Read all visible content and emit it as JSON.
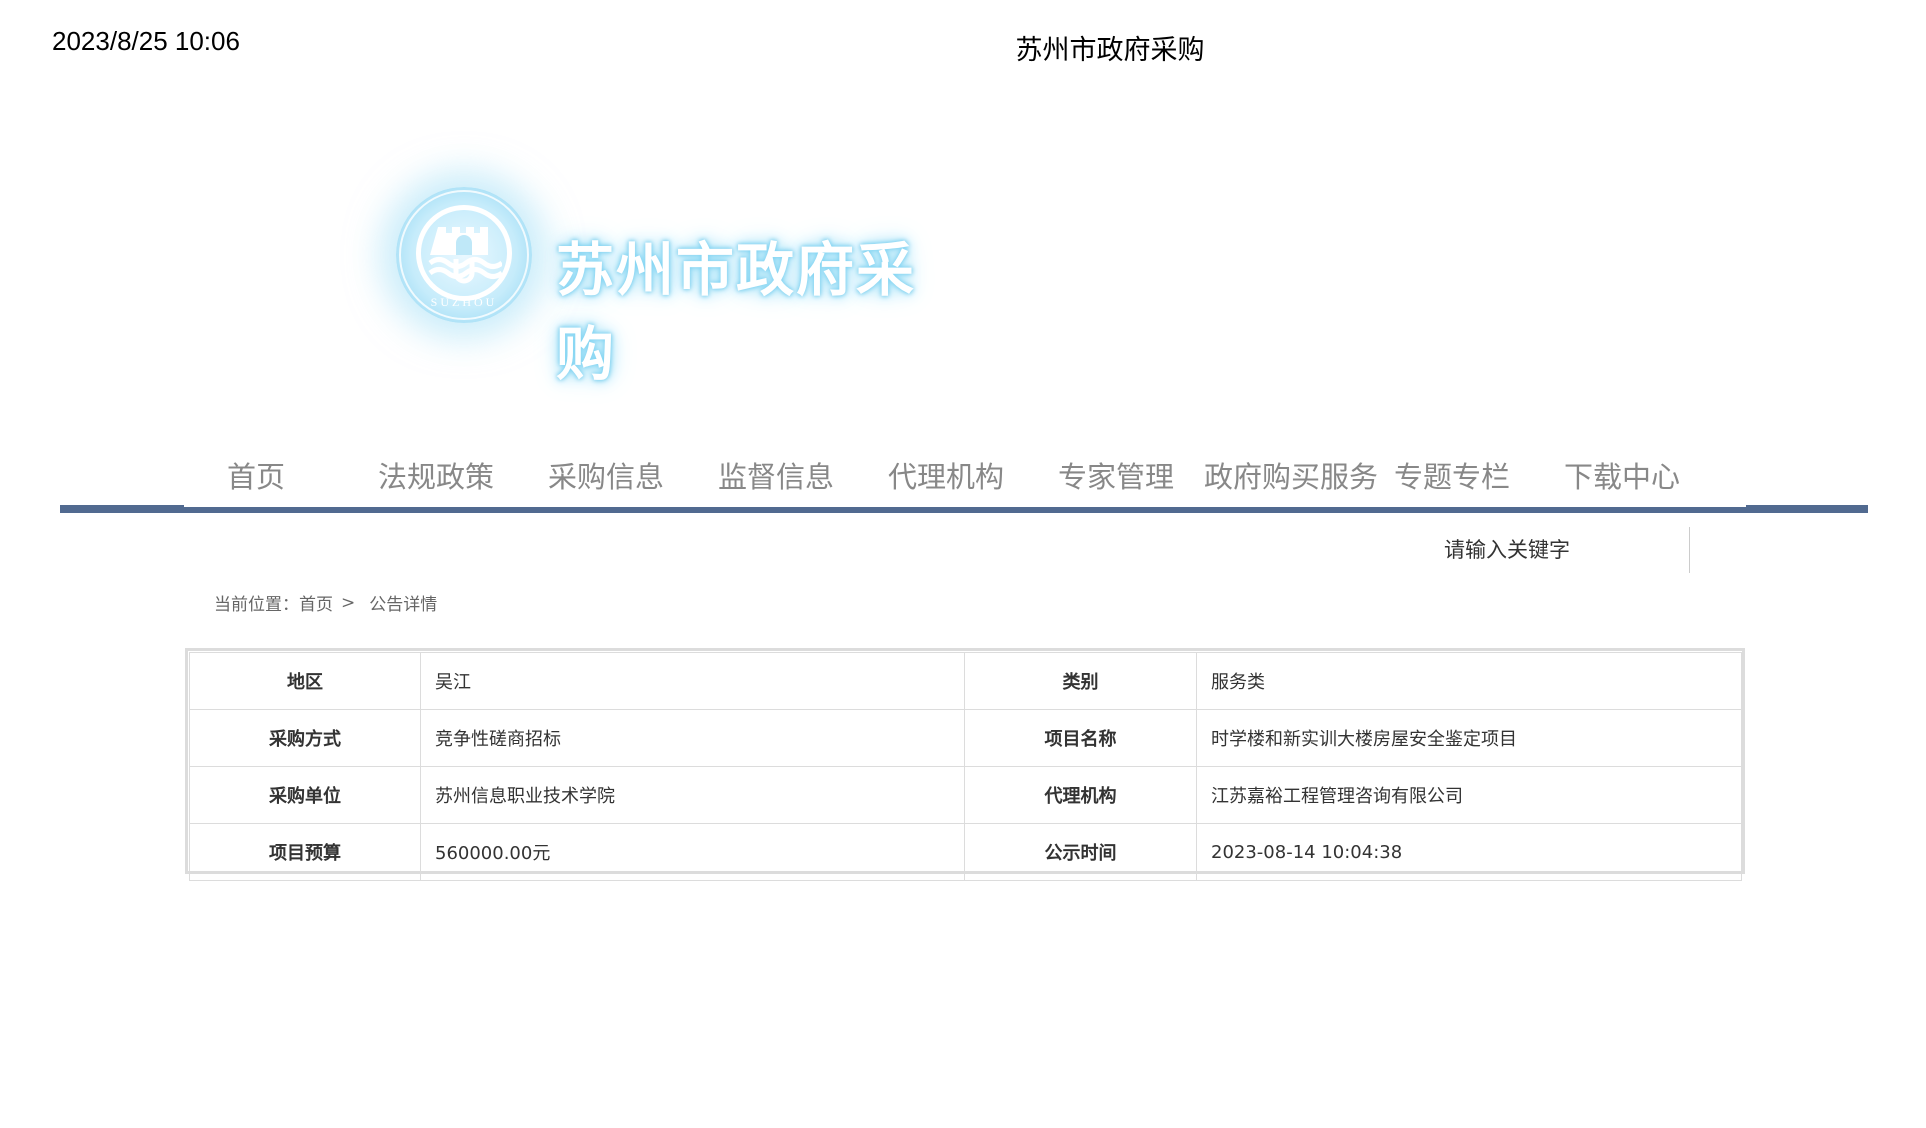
{
  "print_header": {
    "date": "2023/8/25 10:06",
    "title": "苏州市政府采购"
  },
  "logo": {
    "text": "苏州市政府采购",
    "emblem_sub": "SUZHOU"
  },
  "nav": {
    "items": [
      {
        "label": "首页"
      },
      {
        "label": "法规政策"
      },
      {
        "label": "采购信息"
      },
      {
        "label": "监督信息"
      },
      {
        "label": "代理机构"
      },
      {
        "label": "专家管理"
      },
      {
        "label": "政府购买服务"
      },
      {
        "label": "专题专栏"
      },
      {
        "label": "下载中心"
      }
    ],
    "accent_color": "#516a90"
  },
  "search": {
    "placeholder": "请输入关键字"
  },
  "breadcrumb": {
    "prefix": "当前位置：",
    "home": "首页",
    "separator": ">",
    "current": "公告详情"
  },
  "detail": {
    "label_color": "#1a8bc9",
    "rows": [
      [
        {
          "label": "地区",
          "value": "吴江"
        },
        {
          "label": "类别",
          "value": "服务类"
        }
      ],
      [
        {
          "label": "采购方式",
          "value": "竞争性磋商招标"
        },
        {
          "label": "项目名称",
          "value": "时学楼和新实训大楼房屋安全鉴定项目"
        }
      ],
      [
        {
          "label": "采购单位",
          "value": "苏州信息职业技术学院"
        },
        {
          "label": "代理机构",
          "value": "江苏嘉裕工程管理咨询有限公司"
        }
      ],
      [
        {
          "label": "项目预算",
          "value": "560000.00元"
        },
        {
          "label": "公示时间",
          "value": "2023-08-14 10:04:38"
        }
      ]
    ]
  }
}
